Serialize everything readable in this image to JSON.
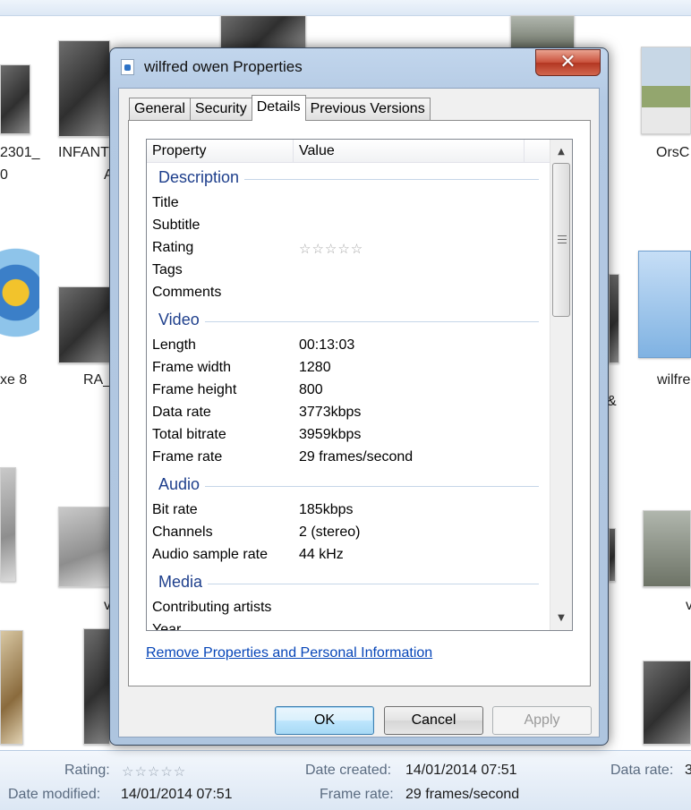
{
  "background": {
    "labels": {
      "left_top": "2301_",
      "left_top_2": "0",
      "infant": "INFANT",
      "infant_2": "A",
      "orsc": "OrsC",
      "axe": "xe 8",
      "ra": "RA_",
      "wilfre": "wilfre",
      "amp": "&",
      "v_left": "v",
      "v_right": "v"
    }
  },
  "dialog": {
    "title": "wilfred owen Properties",
    "close_glyph": "✕",
    "tabs": [
      {
        "label": "General"
      },
      {
        "label": "Security"
      },
      {
        "label": "Details"
      },
      {
        "label": "Previous Versions"
      }
    ],
    "columns": {
      "property": "Property",
      "value": "Value"
    },
    "groups": {
      "description": "Description",
      "video": "Video",
      "audio": "Audio",
      "media": "Media"
    },
    "properties": {
      "title": {
        "label": "Title",
        "value": ""
      },
      "subtitle": {
        "label": "Subtitle",
        "value": ""
      },
      "rating": {
        "label": "Rating",
        "stars": "☆☆☆☆☆",
        "value_stars": 0
      },
      "tags": {
        "label": "Tags",
        "value": ""
      },
      "comments": {
        "label": "Comments",
        "value": ""
      },
      "length": {
        "label": "Length",
        "value": "00:13:03"
      },
      "frame_width": {
        "label": "Frame width",
        "value": "1280"
      },
      "frame_height": {
        "label": "Frame height",
        "value": "800"
      },
      "data_rate": {
        "label": "Data rate",
        "value": "3773kbps"
      },
      "total_bitrate": {
        "label": "Total bitrate",
        "value": "3959kbps"
      },
      "frame_rate": {
        "label": "Frame rate",
        "value": "29 frames/second"
      },
      "bit_rate": {
        "label": "Bit rate",
        "value": "185kbps"
      },
      "channels": {
        "label": "Channels",
        "value": "2 (stereo)"
      },
      "sample_rate": {
        "label": "Audio sample rate",
        "value": "44 kHz"
      },
      "contributing_artists": {
        "label": "Contributing artists",
        "value": ""
      },
      "year": {
        "label": "Year",
        "value": ""
      }
    },
    "remove_link": "Remove Properties and Personal Information",
    "buttons": {
      "ok": "OK",
      "cancel": "Cancel",
      "apply": "Apply"
    }
  },
  "status_bar": {
    "rating_label": "Rating:",
    "rating_stars": "☆☆☆☆☆",
    "date_created_label": "Date created:",
    "date_created_value": "14/01/2014 07:51",
    "data_rate_label": "Data rate:",
    "data_rate_value": "3",
    "date_modified_label": "Date modified:",
    "date_modified_value": "14/01/2014 07:51",
    "frame_rate_label": "Frame rate:",
    "frame_rate_value": "29 frames/second"
  },
  "colors": {
    "group_heading": "#1e3f8c",
    "link": "#0645b8",
    "close_button": "#c9503a",
    "window_frame": "#b3c9e3"
  }
}
